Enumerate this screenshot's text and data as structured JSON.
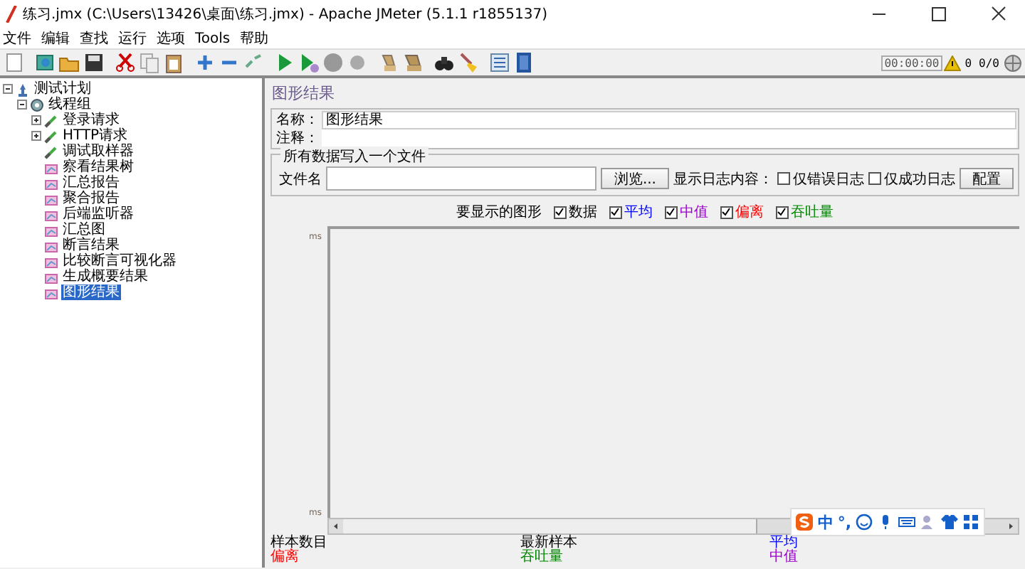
{
  "window": {
    "title": "练习.jmx (C:\\Users\\13426\\桌面\\练习.jmx) - Apache JMeter (5.1.1 r1855137)"
  },
  "menu": [
    "文件",
    "编辑",
    "查找",
    "运行",
    "选项",
    "Tools",
    "帮助"
  ],
  "toolbar_status": {
    "timer": "00:00:00",
    "warnings": "0",
    "threads": "0/0"
  },
  "tree": [
    {
      "label": "测试计划",
      "kind": "plan",
      "selected": false,
      "expanded": true,
      "children": [
        {
          "label": "线程组",
          "kind": "threads",
          "selected": false,
          "expanded": true,
          "children": [
            {
              "label": "登录请求",
              "kind": "sampler",
              "selected": false,
              "expanded": false
            },
            {
              "label": "HTTP请求",
              "kind": "sampler",
              "selected": false,
              "expanded": false
            },
            {
              "label": "调试取样器",
              "kind": "sampler",
              "selected": false
            },
            {
              "label": "察看结果树",
              "kind": "listener",
              "selected": false
            },
            {
              "label": "汇总报告",
              "kind": "listener",
              "selected": false
            },
            {
              "label": "聚合报告",
              "kind": "listener",
              "selected": false
            },
            {
              "label": "后端监听器",
              "kind": "listener",
              "selected": false
            },
            {
              "label": "汇总图",
              "kind": "listener",
              "selected": false
            },
            {
              "label": "断言结果",
              "kind": "listener",
              "selected": false
            },
            {
              "label": "比较断言可视化器",
              "kind": "listener",
              "selected": false
            },
            {
              "label": "生成概要结果",
              "kind": "listener",
              "selected": false
            },
            {
              "label": "图形结果",
              "kind": "listener",
              "selected": true
            }
          ]
        }
      ]
    }
  ],
  "panel": {
    "title": "图形结果",
    "name_label": "名称：",
    "name_value": "图形结果",
    "comment_label": "注释：",
    "file_group": {
      "legend": "所有数据写入一个文件",
      "filename_label": "文件名",
      "browse_button": "浏览...",
      "log_label": "显示日志内容：",
      "options": [
        {
          "label": "仅错误日志",
          "checked": false
        },
        {
          "label": "仅成功日志",
          "checked": false
        }
      ],
      "configure_button": "配置"
    },
    "graphs_label": "要显示的图形",
    "graphs": [
      {
        "label": "数据",
        "checked": true,
        "color": "#000000"
      },
      {
        "label": "平均",
        "checked": true,
        "color": "#0000ff"
      },
      {
        "label": "中值",
        "checked": true,
        "color": "#9900cc"
      },
      {
        "label": "偏离",
        "checked": true,
        "color": "#ff0000"
      },
      {
        "label": "吞吐量",
        "checked": true,
        "color": "#008800"
      }
    ],
    "y_axis_top": "ms",
    "y_axis_bottom": "ms",
    "legend": [
      {
        "label": "样本数目",
        "color": "#000000"
      },
      {
        "label": "最新样本",
        "color": "#000000"
      },
      {
        "label": "平均",
        "color": "#0000ff"
      },
      {
        "label": "偏离",
        "color": "#ff0000"
      },
      {
        "label": "吞吐量",
        "color": "#008800"
      },
      {
        "label": "中值",
        "color": "#9900cc"
      }
    ]
  },
  "ime_bar": {
    "mode": "中",
    "punctuation": "°,"
  }
}
